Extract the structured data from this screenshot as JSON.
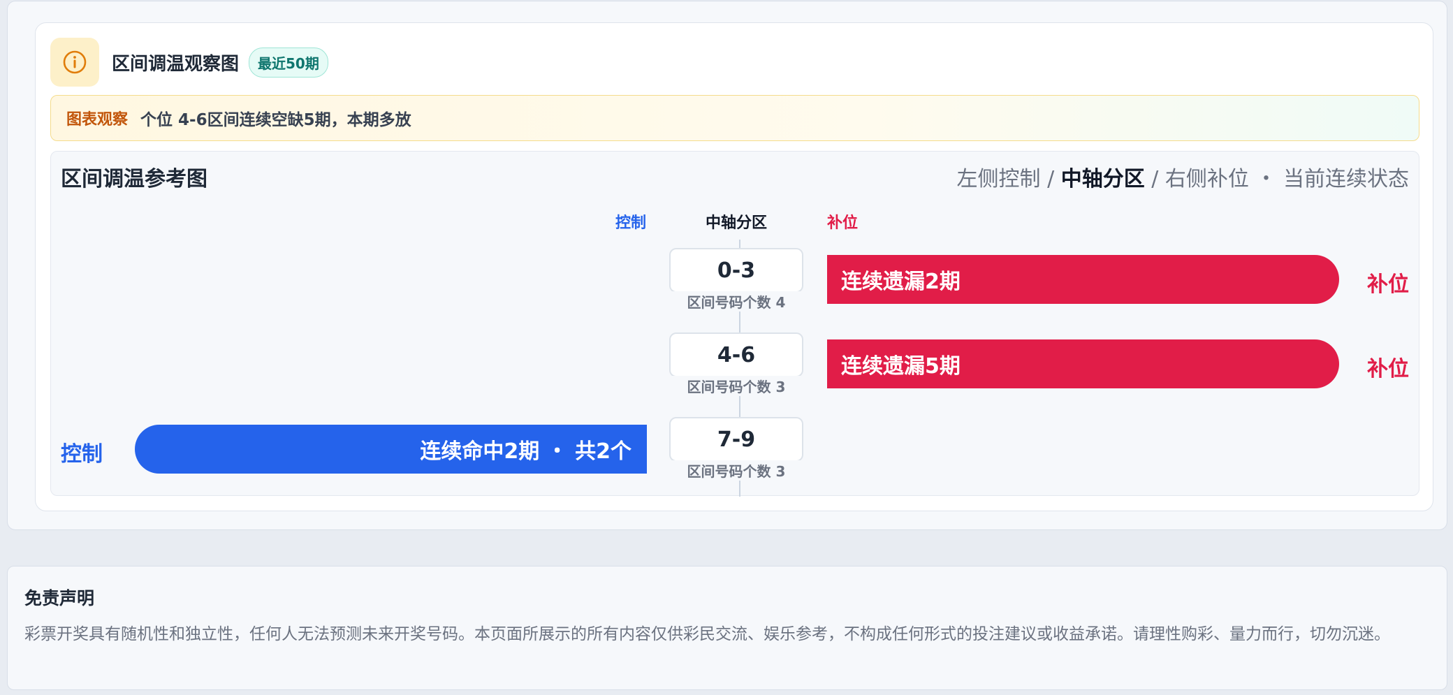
{
  "header": {
    "icon": "info-circle-icon",
    "title": "区间调温观察图",
    "badge": "最近50期"
  },
  "observation": {
    "label": "图表观察",
    "text": "个位 4-6区间连续空缺5期，本期多放"
  },
  "chart": {
    "title": "区间调温参考图",
    "legend": {
      "left": "左侧控制 / ",
      "center": "中轴分区",
      "right": " / 右侧补位 ・ 当前连续状态"
    },
    "columns": {
      "control": "控制",
      "axis": "中轴分区",
      "fill": "补位"
    },
    "rows": [
      {
        "range": "0-3",
        "count_text": "区间号码个数 4",
        "bar_text": "连续遗漏2期",
        "side_label": "补位"
      },
      {
        "range": "4-6",
        "count_text": "区间号码个数 3",
        "bar_text": "连续遗漏5期",
        "side_label": "补位"
      },
      {
        "range": "7-9",
        "count_text": "区间号码个数 3",
        "bar_text": "连续命中2期 ・ 共2个",
        "side_label": "控制"
      }
    ]
  },
  "chart_data": {
    "type": "bar",
    "categories": [
      "0-3",
      "4-6",
      "7-9"
    ],
    "series": [
      {
        "name": "补位",
        "values": [
          2,
          5,
          0
        ]
      },
      {
        "name": "控制",
        "values": [
          0,
          0,
          2
        ]
      }
    ]
  },
  "disclaimer": {
    "title": "免责声明",
    "text": "彩票开奖具有随机性和独立性，任何人无法预测未来开奖号码。本页面所展示的所有内容仅供彩民交流、娱乐参考，不构成任何形式的投注建议或收益承诺。请理性购彩、量力而行，切勿沉迷。"
  },
  "colors": {
    "control": "#2563eb",
    "fill": "#e11d48",
    "badge": "#0f766e",
    "observe_label": "#c2560b"
  }
}
